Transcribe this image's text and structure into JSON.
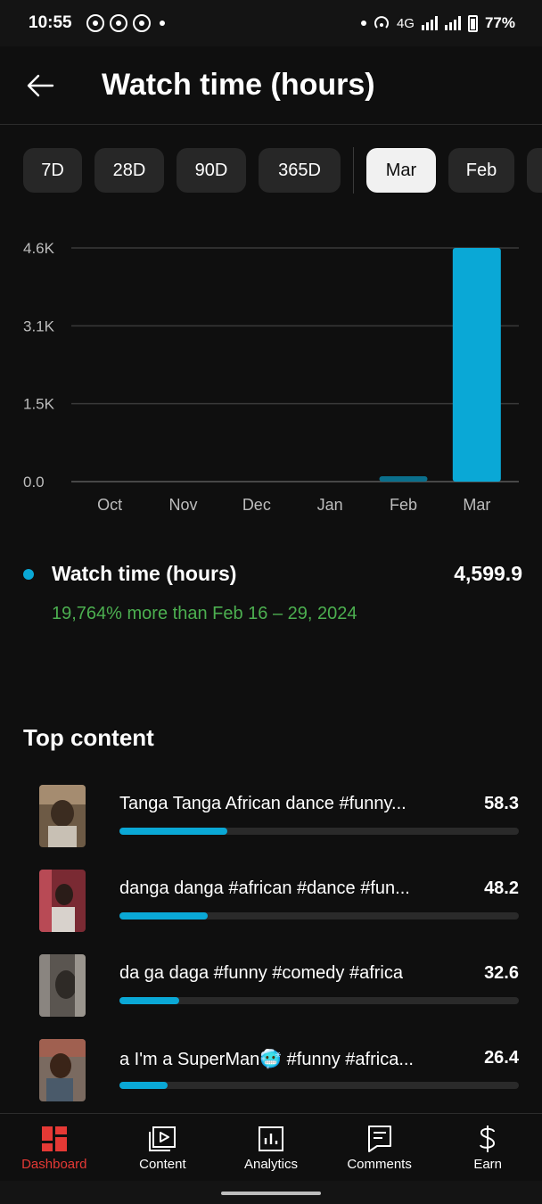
{
  "status": {
    "time": "10:55",
    "network": "4G",
    "battery": "77%"
  },
  "header": {
    "title": "Watch time (hours)"
  },
  "chips": [
    {
      "label": "7D",
      "active": false
    },
    {
      "label": "28D",
      "active": false
    },
    {
      "label": "90D",
      "active": false
    },
    {
      "label": "365D",
      "active": false
    },
    {
      "label": "Mar",
      "active": true
    },
    {
      "label": "Feb",
      "active": false
    }
  ],
  "chart_data": {
    "type": "bar",
    "categories": [
      "Oct",
      "Nov",
      "Dec",
      "Jan",
      "Feb",
      "Mar"
    ],
    "values": [
      0,
      0,
      0,
      0,
      23.2,
      4599.9
    ],
    "y_ticks": [
      "0.0",
      "1.5K",
      "3.1K",
      "4.6K"
    ],
    "y_tick_values": [
      0,
      1533,
      3066,
      4600
    ],
    "ylim": [
      0,
      4600
    ],
    "grid": true,
    "bar_color": "#0aa8d6",
    "faded_bar_color": "#0a6f8c"
  },
  "summary": {
    "label": "Watch time (hours)",
    "value": "4,599.9",
    "comparison": "19,764% more than Feb 16 – 29, 2024",
    "accent": "#0aa8d6",
    "positive_color": "#4caf50"
  },
  "top_content": {
    "title": "Top content",
    "items": [
      {
        "title": "Tanga Tanga African dance #funny...",
        "value": "58.3",
        "share": 0.27
      },
      {
        "title": "danga danga #african #dance #fun...",
        "value": "48.2",
        "share": 0.22
      },
      {
        "title": "da ga daga #funny #comedy #africa",
        "value": "32.6",
        "share": 0.15
      },
      {
        "title": "a I'm a SuperMan🥶 #funny #africa...",
        "value": "26.4",
        "share": 0.12
      }
    ]
  },
  "bottom_nav": [
    {
      "label": "Dashboard",
      "icon": "dashboard-icon",
      "active": true
    },
    {
      "label": "Content",
      "icon": "content-icon",
      "active": false
    },
    {
      "label": "Analytics",
      "icon": "analytics-icon",
      "active": false
    },
    {
      "label": "Comments",
      "icon": "comments-icon",
      "active": false
    },
    {
      "label": "Earn",
      "icon": "earn-icon",
      "active": false
    }
  ]
}
